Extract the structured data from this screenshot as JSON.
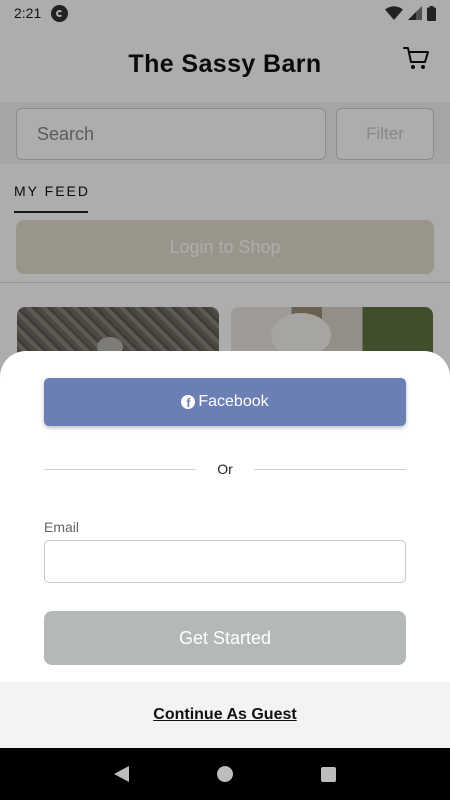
{
  "status_bar": {
    "time": "2:21"
  },
  "header": {
    "title": "The Sassy Barn"
  },
  "search": {
    "placeholder": "Search",
    "filter_label": "Filter"
  },
  "feed": {
    "tab_label": "MY FEED",
    "login_label": "Login to Shop"
  },
  "sheet": {
    "facebook_label": "Facebook",
    "or_label": "Or",
    "email_label": "Email",
    "email_value": "",
    "get_started_label": "Get Started",
    "guest_label": "Continue As Guest"
  },
  "colors": {
    "facebook": "#6b7fb5",
    "get_started_disabled": "#b4b8b8",
    "login_disabled": "#e4dccc"
  },
  "icons": [
    "sync-icon",
    "wifi-icon",
    "signal-icon",
    "battery-icon",
    "cart-icon",
    "facebook-icon",
    "back-icon",
    "home-icon",
    "recents-icon"
  ]
}
